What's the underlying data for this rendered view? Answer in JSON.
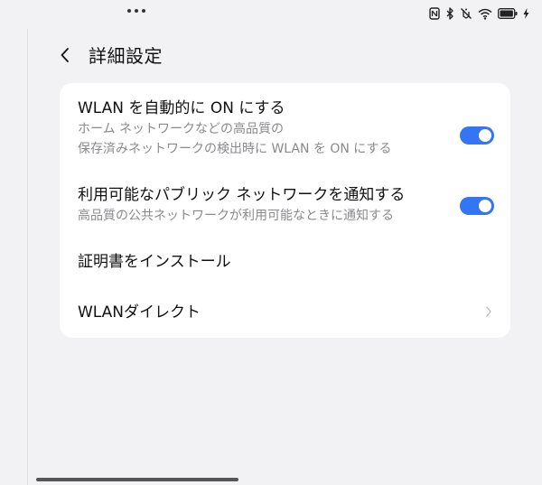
{
  "status_bar": {
    "icons": [
      "nfc-icon",
      "bluetooth-icon",
      "vibrate-off-icon",
      "wifi-icon",
      "battery-icon",
      "charging-icon"
    ]
  },
  "header": {
    "title": "詳細設定"
  },
  "settings": {
    "auto_wlan": {
      "title": "WLAN を自動的に ON にする",
      "subtitle_line1": "ホーム ネットワークなどの高品質の",
      "subtitle_line2": "保存済みネットワークの検出時に WLAN を ON にする",
      "enabled": true
    },
    "public_network": {
      "title": "利用可能なパブリック ネットワークを通知する",
      "subtitle": "高品質の公共ネットワークが利用可能なときに通知する",
      "enabled": true
    },
    "install_cert": {
      "title": "証明書をインストール"
    },
    "wlan_direct": {
      "title": "WLANダイレクト"
    }
  },
  "colors": {
    "accent": "#3375f2",
    "background": "#f2f2f4",
    "card": "#ffffff",
    "subtitle": "#8a8a8e"
  }
}
